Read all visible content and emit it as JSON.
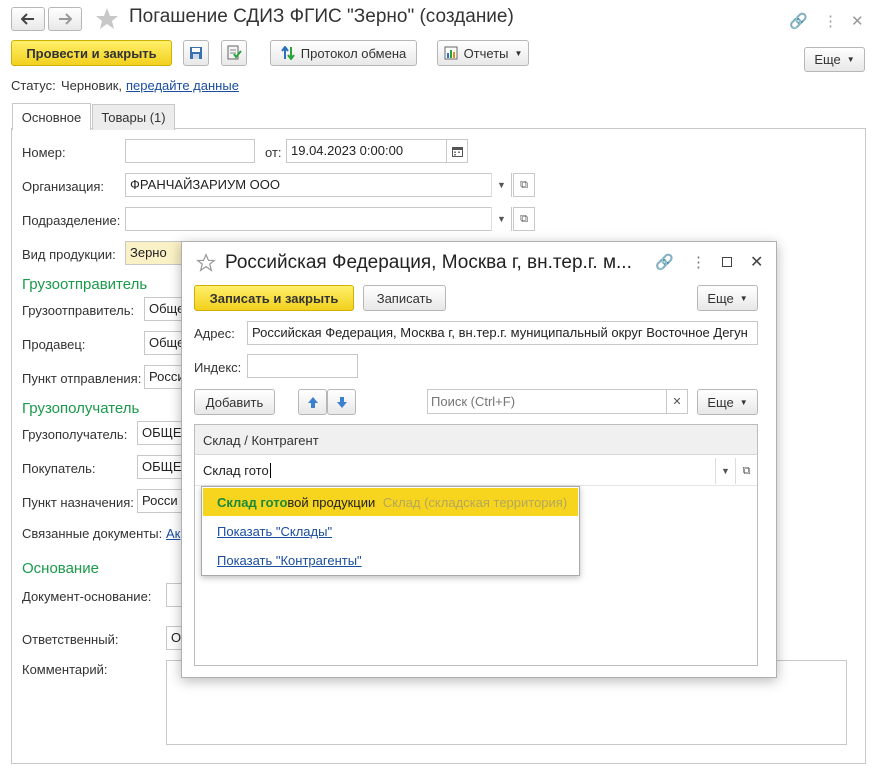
{
  "window": {
    "title": "Погашение СДИЗ ФГИС \"Зерно\" (создание)",
    "back_icon": "arrow-left-icon",
    "forward_icon": "arrow-right-icon"
  },
  "toolbar": {
    "post_close": "Провести и закрыть",
    "exchange_log": "Протокол обмена",
    "reports": "Отчеты",
    "more": "Еще"
  },
  "status": {
    "label": "Статус:",
    "value": "Черновик,",
    "link": "передайте данные"
  },
  "tabs": [
    {
      "label": "Основное",
      "active": true
    },
    {
      "label": "Товары (1)",
      "active": false
    }
  ],
  "form": {
    "number_label": "Номер:",
    "number_value": "",
    "from_label": "от:",
    "date_value": "19.04.2023  0:00:00",
    "org_label": "Организация:",
    "org_value": "ФРАНЧАЙЗАРИУМ ООО",
    "dept_label": "Подразделение:",
    "dept_value": "",
    "product_label": "Вид продукции:",
    "product_value": "Зерно",
    "shipper_group": "Грузоотправитель",
    "shipper_label": "Грузоотправитель:",
    "shipper_value": "Обще",
    "seller_label": "Продавец:",
    "seller_value": "Обще",
    "dispatch_label": "Пункт отправления:",
    "dispatch_value": "Росси",
    "consignee_group": "Грузополучатель",
    "consignee_label": "Грузополучатель:",
    "consignee_value": "ОБЩЕ",
    "buyer_label": "Покупатель:",
    "buyer_value": "ОБЩЕ",
    "dest_label": "Пункт назначения:",
    "dest_value": "Росси",
    "related_label": "Связанные документы:",
    "related_link": "Ак",
    "basis_group": "Основание",
    "basis_doc_label": "Документ-основание:",
    "responsible_label": "Ответственный:",
    "responsible_value": "О",
    "comment_label": "Комментарий:"
  },
  "modal": {
    "title": "Российская Федерация, Москва г, вн.тер.г. м...",
    "save_close": "Записать и закрыть",
    "save": "Записать",
    "more": "Еще",
    "address_label": "Адрес:",
    "address_value": "Российская Федерация, Москва г, вн.тер.г. муниципальный округ Восточное Дегун",
    "index_label": "Индекс:",
    "index_value": "",
    "add": "Добавить",
    "search_placeholder": "Поиск (Ctrl+F)",
    "more2": "Еще",
    "table_header": "Склад / Контрагент",
    "row_input": "Склад гото"
  },
  "autocomplete": {
    "match": "Склад гото",
    "rest": "вой продукции",
    "hint": "Склад (складская территория)",
    "show_warehouses": "Показать \"Склады\"",
    "show_contractors": "Показать \"Контрагенты\""
  }
}
